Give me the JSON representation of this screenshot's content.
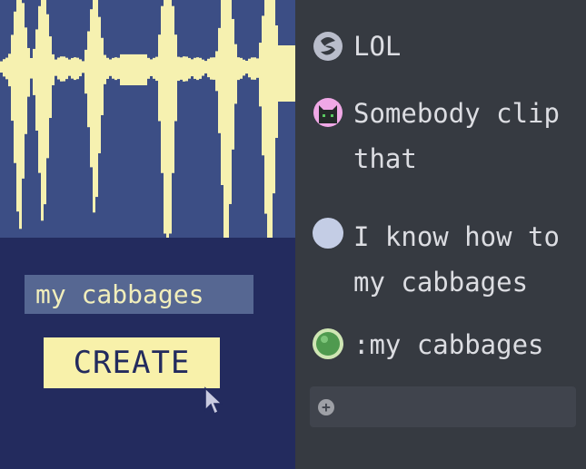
{
  "clip_editor": {
    "name_value": "my cabbages",
    "create_label": "CREATE",
    "colors": {
      "waveform": "#f6f1b0",
      "waveform_bg": "#3c4e85",
      "panel_bg": "#232b5e",
      "button_bg": "#f8f1aa"
    }
  },
  "chat": {
    "messages": [
      {
        "avatar": "swirl-avatar-icon",
        "text": "LOL"
      },
      {
        "avatar": "cat-avatar-icon",
        "text": "Somebody clip\nthat"
      },
      {
        "avatar": "plain-avatar-icon",
        "text": "I know how to\nmy cabbages"
      },
      {
        "avatar": "green-orb-avatar-icon",
        "text": ":my cabbages"
      }
    ],
    "input_icon": "plus-icon"
  }
}
